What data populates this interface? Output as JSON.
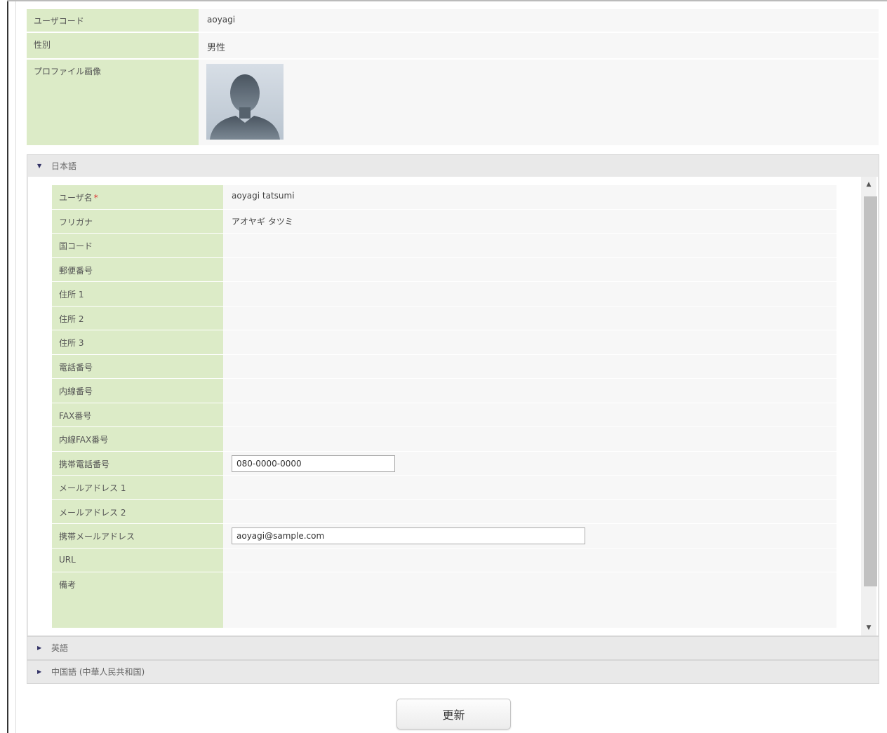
{
  "user_code": {
    "label": "ユーザコード",
    "value": "aoyagi"
  },
  "gender": {
    "label": "性別",
    "value": "男性"
  },
  "profile_image": {
    "label": "プロファイル画像"
  },
  "sections": {
    "japanese": {
      "title": "日本語",
      "expanded": true,
      "fields": {
        "user_name": {
          "label": "ユーザ名",
          "value": "aoyagi tatsumi",
          "required_mark": "*"
        },
        "furigana": {
          "label": "フリガナ",
          "value": "アオヤギ タツミ"
        },
        "country_code": {
          "label": "国コード",
          "value": ""
        },
        "postal_code": {
          "label": "郵便番号",
          "value": ""
        },
        "address1": {
          "label": "住所 1",
          "value": ""
        },
        "address2": {
          "label": "住所 2",
          "value": ""
        },
        "address3": {
          "label": "住所 3",
          "value": ""
        },
        "phone": {
          "label": "電話番号",
          "value": ""
        },
        "extension": {
          "label": "内線番号",
          "value": ""
        },
        "fax": {
          "label": "FAX番号",
          "value": ""
        },
        "extension_fax": {
          "label": "内線FAX番号",
          "value": ""
        },
        "mobile_phone": {
          "label": "携帯電話番号",
          "value": "080-0000-0000"
        },
        "email1": {
          "label": "メールアドレス 1",
          "value": ""
        },
        "email2": {
          "label": "メールアドレス 2",
          "value": ""
        },
        "mobile_email": {
          "label": "携帯メールアドレス",
          "value": "aoyagi@sample.com"
        },
        "url": {
          "label": "URL",
          "value": ""
        },
        "notes": {
          "label": "備考",
          "value": ""
        }
      }
    },
    "english": {
      "title": "英語",
      "expanded": false
    },
    "chinese": {
      "title": "中国語 (中華人民共和国)",
      "expanded": false
    }
  },
  "actions": {
    "update_label": "更新"
  },
  "colors": {
    "label_bg": "#dcebc7",
    "value_bg": "#f7f7f7",
    "required": "#dd3333"
  }
}
